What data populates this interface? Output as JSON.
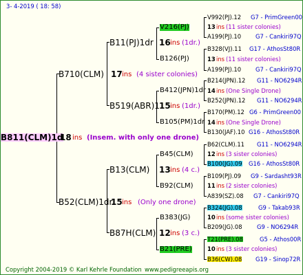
{
  "header": {
    "date": "3-  4-2019  ( 18:  58)"
  },
  "root": {
    "name": "B811(CLM)1d",
    "ins": "18",
    "ins_label": "ins",
    "note": "(Insem. with only one drone)"
  },
  "gen1": [
    {
      "name": "B710(CLM)",
      "ins": "17",
      "ins_label": "ins",
      "note": "(4 sister colonies)"
    },
    {
      "name": "B52(CLM)1dr",
      "ins": "15",
      "ins_label": "ins",
      "note": "(Only one drone)"
    }
  ],
  "gen2": [
    {
      "name": "B11(PJ)1dr",
      "ins": "16",
      "ins_label": "ins",
      "note": "(1dr.)"
    },
    {
      "name": "B519(ABR)1",
      "ins": "15",
      "ins_label": "ins",
      "note": "(1dr.)"
    },
    {
      "name": "B13(CLM)",
      "ins": "13",
      "ins_label": "ins",
      "note": "(4 c.)"
    },
    {
      "name": "B87H(CLM)",
      "ins": "12",
      "ins_label": "ins",
      "note": "(3 c.)"
    }
  ],
  "gen3": [
    {
      "name": "V216(PJ)"
    },
    {
      "name": "B126(PJ)"
    },
    {
      "name": "B412(JPN)1dr",
      "ins": "14",
      "ins_label": "ins",
      "note": "(One Single Drone)"
    },
    {
      "name": "B105(PM)1dr"
    },
    {
      "name": "B45(CLM)"
    },
    {
      "name": "B92(CLM)"
    },
    {
      "name": "B383(JG)"
    },
    {
      "name": "B21(PRE)"
    }
  ],
  "gen4": [
    {
      "name": "V992(PJ).12",
      "code": "G7 - PrimGreen00"
    },
    {
      "ins": "13",
      "ins_label": "ins",
      "note": "(11 sister colonies)"
    },
    {
      "name": "A199(PJ).10",
      "code": "G7 - Cankiri97Q"
    },
    {
      "name": "B328(VJ).11",
      "code": "G17 - AthosSt80R"
    },
    {
      "ins": "13",
      "ins_label": "ins",
      "note": "(11 sister colonies)"
    },
    {
      "name": "A199(PJ).10",
      "code": "G7 - Cankiri97Q"
    },
    {
      "name": "B214(JPN).12",
      "code": "G11 - NO6294R"
    },
    {
      "ins": "14",
      "ins_label": "ins",
      "note": "(One Single Drone)"
    },
    {
      "name": "B252(JPN).12",
      "code": "G11 - NO6294R"
    },
    {
      "name": "B170(PM).12",
      "code": "G6 - PrimGreen00"
    },
    {
      "ins": "14",
      "ins_label": "ins",
      "note": "(One Single Drone)"
    },
    {
      "name": "B130(JAF).10",
      "code": "G16 - AthosSt80R"
    },
    {
      "name": "B62(CLM).11",
      "code": "G11 - NO6294R"
    },
    {
      "ins": "12",
      "ins_label": "ins",
      "note": "(3 sister colonies)"
    },
    {
      "name": "B100(JG).09",
      "code": "G16 - AthosSt80R"
    },
    {
      "name": "B109(PJ).09",
      "code": "G9 - Sardasht93R"
    },
    {
      "ins": "11",
      "ins_label": "ins",
      "note": "(2 sister colonies)"
    },
    {
      "name": "A839(SZ).08",
      "code": "G7 - Cankiri97Q"
    },
    {
      "name": "B324(JG).08",
      "code": "G9 - Takab93R"
    },
    {
      "ins": "10",
      "ins_label": "ins",
      "note": "(some sister colonies)"
    },
    {
      "name": "B209(JG).08",
      "code": "G9 - NO6294R"
    },
    {
      "name": "T21(PRE).08",
      "code": "G5 - Athos00R"
    },
    {
      "ins": "10",
      "ins_label": "ins",
      "note": "(3 sister colonies)"
    },
    {
      "name": "B36(CW).08",
      "code": "G19 - Sinop72R"
    }
  ],
  "footer": {
    "copyright": "Copyright 2004-2019 © Karl Kehrle Foundation",
    "url": "www.pedigreeapis.org"
  }
}
